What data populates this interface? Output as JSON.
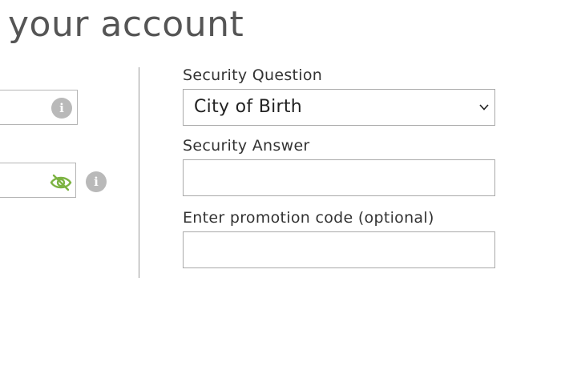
{
  "header": {
    "title": "your account"
  },
  "left_column": {
    "field_one": {
      "value": "",
      "info_icon": "info-icon"
    },
    "field_two": {
      "value": "",
      "visibility_icon": "eye-slash-icon",
      "info_icon": "info-icon"
    },
    "info_glyph": "i"
  },
  "security": {
    "question_label": "Security Question",
    "question_selected": "City of Birth",
    "answer_label": "Security Answer",
    "answer_value": ""
  },
  "promotion": {
    "label": "Enter promotion code (optional)",
    "value": ""
  },
  "colors": {
    "eye_icon": "#7cb342",
    "info_icon_bg": "#b9b9b9",
    "border": "#a9a9a9",
    "title": "#555555"
  }
}
